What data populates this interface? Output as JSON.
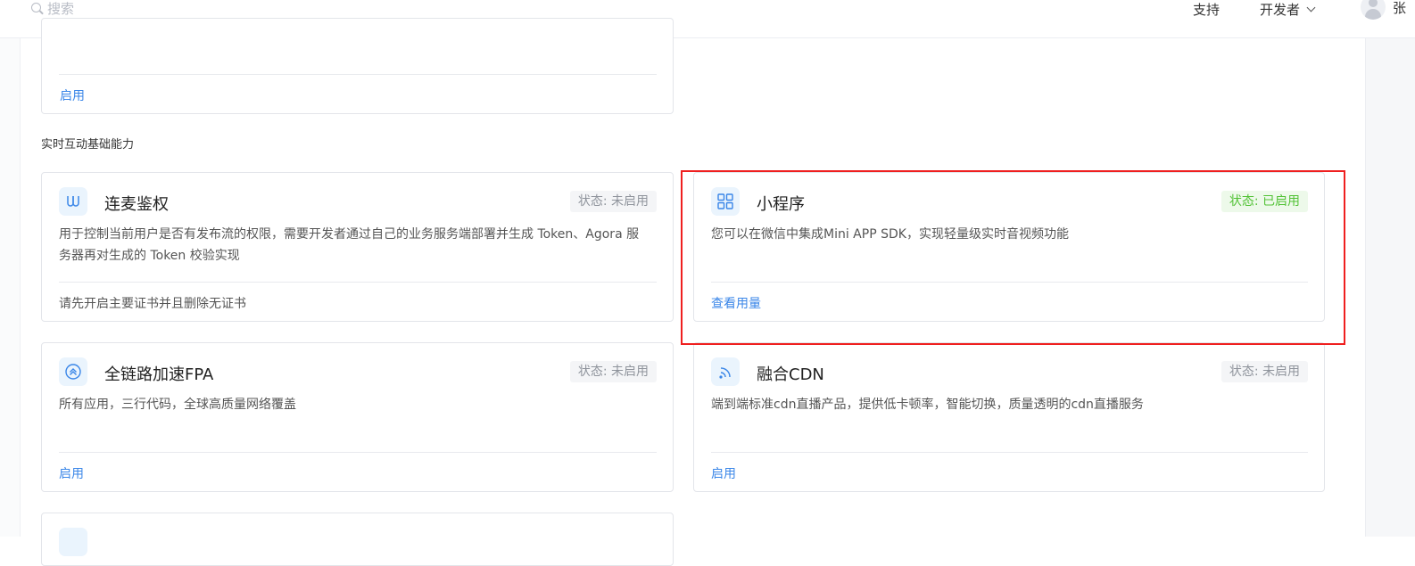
{
  "header": {
    "search_placeholder": "搜索",
    "support": "支持",
    "developer": "开发者",
    "user_name": "张"
  },
  "top_card": {
    "action": "启用"
  },
  "section": {
    "title": "实时互动基础能力"
  },
  "cards": [
    {
      "title": "连麦鉴权",
      "status": "状态: 未启用",
      "desc_line1": "用于控制当前用户是否有发布流的权限，需要开发者通过自己的业务服务端部署并生成 Token、Agora 服",
      "desc_line2": "务器再对生成的 Token 校验实现",
      "note": "请先开启主要证书并且删除无证书"
    },
    {
      "title": "小程序",
      "status": "状态: 已启用",
      "desc": "您可以在微信中集成Mini APP SDK，实现轻量级实时音视频功能",
      "action": "查看用量"
    },
    {
      "title": "全链路加速FPA",
      "status": "状态: 未启用",
      "desc": "所有应用，三行代码，全球高质量网络覆盖",
      "action": "启用"
    },
    {
      "title": "融合CDN",
      "status": "状态: 未启用",
      "desc": "端到端标准cdn直播产品，提供低卡顿率，智能切换，质量透明的cdn直播服务",
      "action": "启用"
    }
  ],
  "colors": {
    "accent": "#3a86e8",
    "enabled": "#52c236",
    "highlight": "#ef1f1f"
  }
}
